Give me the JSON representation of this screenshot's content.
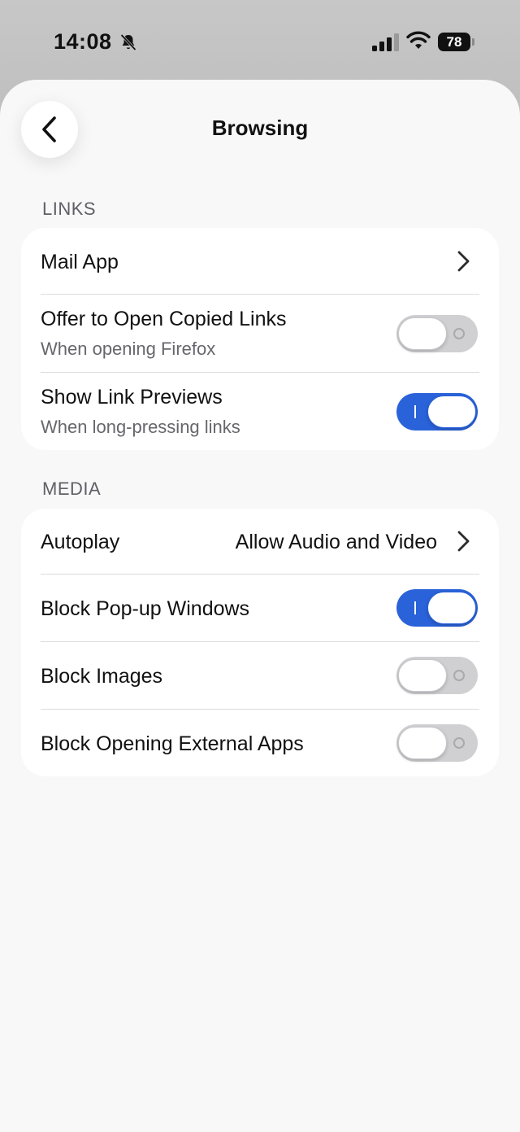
{
  "status_bar": {
    "time": "14:08",
    "battery": "78"
  },
  "header": {
    "title": "Browsing"
  },
  "links_section": {
    "header": "LINKS",
    "mail_app": {
      "label": "Mail App"
    },
    "offer_copied_links": {
      "label": "Offer to Open Copied Links",
      "subtitle": "When opening Firefox",
      "enabled": false
    },
    "show_link_previews": {
      "label": "Show Link Previews",
      "subtitle": "When long-pressing links",
      "enabled": true
    }
  },
  "media_section": {
    "header": "MEDIA",
    "autoplay": {
      "label": "Autoplay",
      "value": "Allow Audio and Video"
    },
    "block_popups": {
      "label": "Block Pop-up Windows",
      "enabled": true
    },
    "block_images": {
      "label": "Block Images",
      "enabled": false
    },
    "block_external_apps": {
      "label": "Block Opening External Apps",
      "enabled": false
    }
  },
  "colors": {
    "toggle_on": "#2a62d9",
    "toggle_off": "#d0d0d3",
    "sheet_background": "#f8f8f9"
  }
}
